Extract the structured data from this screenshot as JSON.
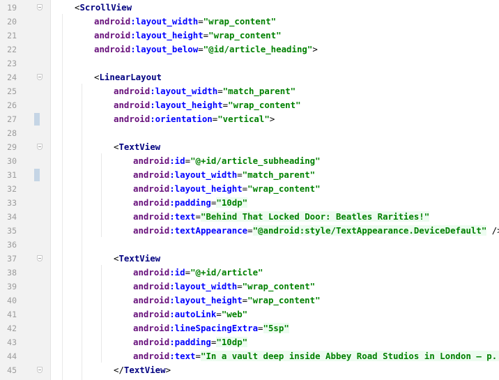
{
  "editor": {
    "lines": [
      {
        "num": "19",
        "indent": 4,
        "fold": true,
        "marker": false,
        "tokens": [
          {
            "t": "brk",
            "v": "<"
          },
          {
            "t": "tag",
            "v": "ScrollView"
          }
        ]
      },
      {
        "num": "20",
        "indent": 8,
        "fold": false,
        "marker": false,
        "tokens": [
          {
            "t": "ns",
            "v": "android"
          },
          {
            "t": "attr",
            "v": ":layout_width"
          },
          {
            "t": "brk",
            "v": "="
          },
          {
            "t": "val",
            "v": "\"wrap_content\""
          }
        ]
      },
      {
        "num": "21",
        "indent": 8,
        "fold": false,
        "marker": false,
        "tokens": [
          {
            "t": "ns",
            "v": "android"
          },
          {
            "t": "attr",
            "v": ":layout_height"
          },
          {
            "t": "brk",
            "v": "="
          },
          {
            "t": "val",
            "v": "\"wrap_content\""
          }
        ]
      },
      {
        "num": "22",
        "indent": 8,
        "fold": false,
        "marker": false,
        "tokens": [
          {
            "t": "ns",
            "v": "android"
          },
          {
            "t": "attr",
            "v": ":layout_below"
          },
          {
            "t": "brk",
            "v": "="
          },
          {
            "t": "val",
            "v": "\"@id/article_heading\""
          },
          {
            "t": "brk",
            "v": ">"
          }
        ]
      },
      {
        "num": "23",
        "indent": 0,
        "fold": false,
        "marker": false,
        "tokens": []
      },
      {
        "num": "24",
        "indent": 8,
        "fold": true,
        "marker": false,
        "tokens": [
          {
            "t": "brk",
            "v": "<"
          },
          {
            "t": "tag",
            "v": "LinearLayout"
          }
        ]
      },
      {
        "num": "25",
        "indent": 12,
        "fold": false,
        "marker": false,
        "tokens": [
          {
            "t": "ns",
            "v": "android"
          },
          {
            "t": "attr",
            "v": ":layout_width"
          },
          {
            "t": "brk",
            "v": "="
          },
          {
            "t": "val",
            "v": "\"match_parent\""
          }
        ]
      },
      {
        "num": "26",
        "indent": 12,
        "fold": false,
        "marker": false,
        "tokens": [
          {
            "t": "ns",
            "v": "android"
          },
          {
            "t": "attr",
            "v": ":layout_height"
          },
          {
            "t": "brk",
            "v": "="
          },
          {
            "t": "val",
            "v": "\"wrap_content\""
          }
        ]
      },
      {
        "num": "27",
        "indent": 12,
        "fold": false,
        "marker": true,
        "tokens": [
          {
            "t": "ns",
            "v": "android"
          },
          {
            "t": "attr",
            "v": ":orientation"
          },
          {
            "t": "brk",
            "v": "="
          },
          {
            "t": "val",
            "v": "\"vertical\""
          },
          {
            "t": "brk",
            "v": ">"
          }
        ]
      },
      {
        "num": "28",
        "indent": 0,
        "fold": false,
        "marker": false,
        "tokens": []
      },
      {
        "num": "29",
        "indent": 12,
        "fold": true,
        "marker": false,
        "tokens": [
          {
            "t": "brk",
            "v": "<"
          },
          {
            "t": "tag",
            "v": "TextView"
          }
        ]
      },
      {
        "num": "30",
        "indent": 16,
        "fold": false,
        "marker": false,
        "tokens": [
          {
            "t": "ns",
            "v": "android"
          },
          {
            "t": "attr",
            "v": ":id"
          },
          {
            "t": "brk",
            "v": "="
          },
          {
            "t": "val",
            "v": "\"@+id/article_subheading\""
          }
        ]
      },
      {
        "num": "31",
        "indent": 16,
        "fold": false,
        "marker": true,
        "tokens": [
          {
            "t": "ns",
            "v": "android"
          },
          {
            "t": "attr",
            "v": ":layout_width"
          },
          {
            "t": "brk",
            "v": "="
          },
          {
            "t": "val",
            "v": "\"match_parent\""
          }
        ]
      },
      {
        "num": "32",
        "indent": 16,
        "fold": false,
        "marker": false,
        "tokens": [
          {
            "t": "ns",
            "v": "android"
          },
          {
            "t": "attr",
            "v": ":layout_height"
          },
          {
            "t": "brk",
            "v": "="
          },
          {
            "t": "val",
            "v": "\"wrap_content\""
          }
        ]
      },
      {
        "num": "33",
        "indent": 16,
        "fold": false,
        "marker": false,
        "tokens": [
          {
            "t": "ns",
            "v": "android"
          },
          {
            "t": "attr",
            "v": ":padding"
          },
          {
            "t": "brk",
            "v": "="
          },
          {
            "t": "hl",
            "v": "\"10dp\""
          }
        ]
      },
      {
        "num": "34",
        "indent": 16,
        "fold": false,
        "marker": false,
        "tokens": [
          {
            "t": "ns",
            "v": "android"
          },
          {
            "t": "attr",
            "v": ":text"
          },
          {
            "t": "brk",
            "v": "="
          },
          {
            "t": "hl",
            "v": "\"Behind That Locked Door: Beatles Rarities!\""
          }
        ]
      },
      {
        "num": "35",
        "indent": 16,
        "fold": false,
        "marker": false,
        "tokens": [
          {
            "t": "ns",
            "v": "android"
          },
          {
            "t": "attr",
            "v": ":textAppearance"
          },
          {
            "t": "brk",
            "v": "="
          },
          {
            "t": "hl",
            "v": "\"@android:style/TextAppearance.DeviceDefault\""
          },
          {
            "t": "brk",
            "v": " />"
          }
        ]
      },
      {
        "num": "36",
        "indent": 0,
        "fold": false,
        "marker": false,
        "tokens": []
      },
      {
        "num": "37",
        "indent": 12,
        "fold": true,
        "marker": false,
        "tokens": [
          {
            "t": "brk",
            "v": "<"
          },
          {
            "t": "tag",
            "v": "TextView"
          }
        ]
      },
      {
        "num": "38",
        "indent": 16,
        "fold": false,
        "marker": false,
        "tokens": [
          {
            "t": "ns",
            "v": "android"
          },
          {
            "t": "attr",
            "v": ":id"
          },
          {
            "t": "brk",
            "v": "="
          },
          {
            "t": "val",
            "v": "\"@+id/article\""
          }
        ]
      },
      {
        "num": "39",
        "indent": 16,
        "fold": false,
        "marker": false,
        "tokens": [
          {
            "t": "ns",
            "v": "android"
          },
          {
            "t": "attr",
            "v": ":layout_width"
          },
          {
            "t": "brk",
            "v": "="
          },
          {
            "t": "val",
            "v": "\"wrap_content\""
          }
        ]
      },
      {
        "num": "40",
        "indent": 16,
        "fold": false,
        "marker": false,
        "tokens": [
          {
            "t": "ns",
            "v": "android"
          },
          {
            "t": "attr",
            "v": ":layout_height"
          },
          {
            "t": "brk",
            "v": "="
          },
          {
            "t": "val",
            "v": "\"wrap_content\""
          }
        ]
      },
      {
        "num": "41",
        "indent": 16,
        "fold": false,
        "marker": false,
        "tokens": [
          {
            "t": "ns",
            "v": "android"
          },
          {
            "t": "attr",
            "v": ":autoLink"
          },
          {
            "t": "brk",
            "v": "="
          },
          {
            "t": "val",
            "v": "\"web\""
          }
        ]
      },
      {
        "num": "42",
        "indent": 16,
        "fold": false,
        "marker": false,
        "tokens": [
          {
            "t": "ns",
            "v": "android"
          },
          {
            "t": "attr",
            "v": ":lineSpacingExtra"
          },
          {
            "t": "brk",
            "v": "="
          },
          {
            "t": "hl",
            "v": "\"5sp\""
          }
        ]
      },
      {
        "num": "43",
        "indent": 16,
        "fold": false,
        "marker": false,
        "tokens": [
          {
            "t": "ns",
            "v": "android"
          },
          {
            "t": "attr",
            "v": ":padding"
          },
          {
            "t": "brk",
            "v": "="
          },
          {
            "t": "hl",
            "v": "\"10dp\""
          }
        ]
      },
      {
        "num": "44",
        "indent": 16,
        "fold": false,
        "marker": false,
        "tokens": [
          {
            "t": "ns",
            "v": "android"
          },
          {
            "t": "attr",
            "v": ":text"
          },
          {
            "t": "brk",
            "v": "="
          },
          {
            "t": "hl",
            "v": "\"In a vault deep inside Abbey Road Studios in London – p...\""
          },
          {
            "t": "brk",
            "v": " >"
          }
        ]
      },
      {
        "num": "45",
        "indent": 12,
        "fold": true,
        "marker": false,
        "tokens": [
          {
            "t": "brk",
            "v": "</"
          },
          {
            "t": "tag",
            "v": "TextView"
          },
          {
            "t": "brk",
            "v": ">"
          }
        ]
      }
    ]
  },
  "colors": {
    "gutter_bg": "#f2f2f2",
    "tag": "#000080",
    "namespace": "#660e7a",
    "attribute": "#0000ff",
    "value": "#008000",
    "value_highlight_bg": "#edfcf0",
    "change_marker": "#c5d5e5"
  }
}
